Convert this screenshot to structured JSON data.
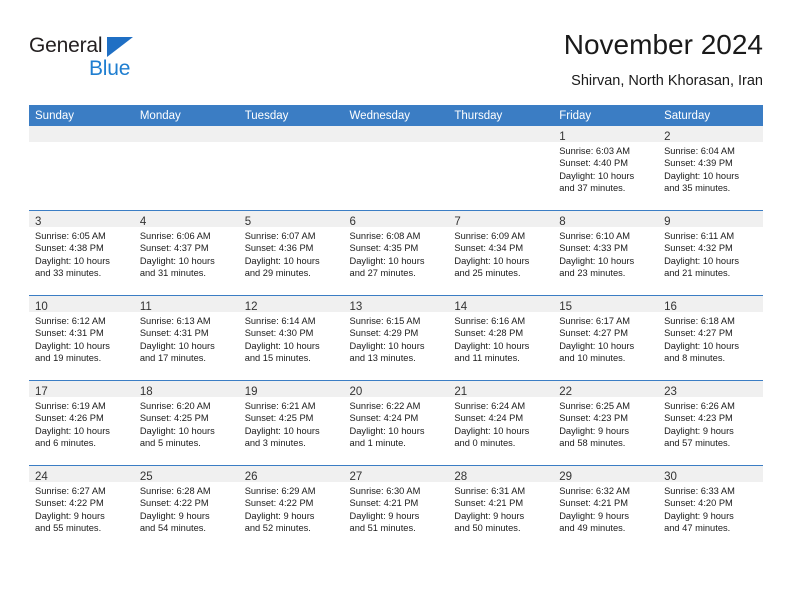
{
  "logo": {
    "word_one": "General",
    "word_two": "Blue",
    "triangle_icon": "triangle-icon",
    "brand_blue": "#1f7ed0"
  },
  "header": {
    "title": "November 2024",
    "subtitle": "Shirvan, North Khorasan, Iran"
  },
  "colors": {
    "header_blue": "#3b7dc4",
    "daynum_band": "#f0f0f0",
    "text": "#1a1a1a"
  },
  "weekday_headers": [
    "Sunday",
    "Monday",
    "Tuesday",
    "Wednesday",
    "Thursday",
    "Friday",
    "Saturday"
  ],
  "weeks": [
    [
      {
        "day": "",
        "lines": []
      },
      {
        "day": "",
        "lines": []
      },
      {
        "day": "",
        "lines": []
      },
      {
        "day": "",
        "lines": []
      },
      {
        "day": "",
        "lines": []
      },
      {
        "day": "1",
        "lines": [
          "Sunrise: 6:03 AM",
          "Sunset: 4:40 PM",
          "Daylight: 10 hours",
          "and 37 minutes."
        ]
      },
      {
        "day": "2",
        "lines": [
          "Sunrise: 6:04 AM",
          "Sunset: 4:39 PM",
          "Daylight: 10 hours",
          "and 35 minutes."
        ]
      }
    ],
    [
      {
        "day": "3",
        "lines": [
          "Sunrise: 6:05 AM",
          "Sunset: 4:38 PM",
          "Daylight: 10 hours",
          "and 33 minutes."
        ]
      },
      {
        "day": "4",
        "lines": [
          "Sunrise: 6:06 AM",
          "Sunset: 4:37 PM",
          "Daylight: 10 hours",
          "and 31 minutes."
        ]
      },
      {
        "day": "5",
        "lines": [
          "Sunrise: 6:07 AM",
          "Sunset: 4:36 PM",
          "Daylight: 10 hours",
          "and 29 minutes."
        ]
      },
      {
        "day": "6",
        "lines": [
          "Sunrise: 6:08 AM",
          "Sunset: 4:35 PM",
          "Daylight: 10 hours",
          "and 27 minutes."
        ]
      },
      {
        "day": "7",
        "lines": [
          "Sunrise: 6:09 AM",
          "Sunset: 4:34 PM",
          "Daylight: 10 hours",
          "and 25 minutes."
        ]
      },
      {
        "day": "8",
        "lines": [
          "Sunrise: 6:10 AM",
          "Sunset: 4:33 PM",
          "Daylight: 10 hours",
          "and 23 minutes."
        ]
      },
      {
        "day": "9",
        "lines": [
          "Sunrise: 6:11 AM",
          "Sunset: 4:32 PM",
          "Daylight: 10 hours",
          "and 21 minutes."
        ]
      }
    ],
    [
      {
        "day": "10",
        "lines": [
          "Sunrise: 6:12 AM",
          "Sunset: 4:31 PM",
          "Daylight: 10 hours",
          "and 19 minutes."
        ]
      },
      {
        "day": "11",
        "lines": [
          "Sunrise: 6:13 AM",
          "Sunset: 4:31 PM",
          "Daylight: 10 hours",
          "and 17 minutes."
        ]
      },
      {
        "day": "12",
        "lines": [
          "Sunrise: 6:14 AM",
          "Sunset: 4:30 PM",
          "Daylight: 10 hours",
          "and 15 minutes."
        ]
      },
      {
        "day": "13",
        "lines": [
          "Sunrise: 6:15 AM",
          "Sunset: 4:29 PM",
          "Daylight: 10 hours",
          "and 13 minutes."
        ]
      },
      {
        "day": "14",
        "lines": [
          "Sunrise: 6:16 AM",
          "Sunset: 4:28 PM",
          "Daylight: 10 hours",
          "and 11 minutes."
        ]
      },
      {
        "day": "15",
        "lines": [
          "Sunrise: 6:17 AM",
          "Sunset: 4:27 PM",
          "Daylight: 10 hours",
          "and 10 minutes."
        ]
      },
      {
        "day": "16",
        "lines": [
          "Sunrise: 6:18 AM",
          "Sunset: 4:27 PM",
          "Daylight: 10 hours",
          "and 8 minutes."
        ]
      }
    ],
    [
      {
        "day": "17",
        "lines": [
          "Sunrise: 6:19 AM",
          "Sunset: 4:26 PM",
          "Daylight: 10 hours",
          "and 6 minutes."
        ]
      },
      {
        "day": "18",
        "lines": [
          "Sunrise: 6:20 AM",
          "Sunset: 4:25 PM",
          "Daylight: 10 hours",
          "and 5 minutes."
        ]
      },
      {
        "day": "19",
        "lines": [
          "Sunrise: 6:21 AM",
          "Sunset: 4:25 PM",
          "Daylight: 10 hours",
          "and 3 minutes."
        ]
      },
      {
        "day": "20",
        "lines": [
          "Sunrise: 6:22 AM",
          "Sunset: 4:24 PM",
          "Daylight: 10 hours",
          "and 1 minute."
        ]
      },
      {
        "day": "21",
        "lines": [
          "Sunrise: 6:24 AM",
          "Sunset: 4:24 PM",
          "Daylight: 10 hours",
          "and 0 minutes."
        ]
      },
      {
        "day": "22",
        "lines": [
          "Sunrise: 6:25 AM",
          "Sunset: 4:23 PM",
          "Daylight: 9 hours",
          "and 58 minutes."
        ]
      },
      {
        "day": "23",
        "lines": [
          "Sunrise: 6:26 AM",
          "Sunset: 4:23 PM",
          "Daylight: 9 hours",
          "and 57 minutes."
        ]
      }
    ],
    [
      {
        "day": "24",
        "lines": [
          "Sunrise: 6:27 AM",
          "Sunset: 4:22 PM",
          "Daylight: 9 hours",
          "and 55 minutes."
        ]
      },
      {
        "day": "25",
        "lines": [
          "Sunrise: 6:28 AM",
          "Sunset: 4:22 PM",
          "Daylight: 9 hours",
          "and 54 minutes."
        ]
      },
      {
        "day": "26",
        "lines": [
          "Sunrise: 6:29 AM",
          "Sunset: 4:22 PM",
          "Daylight: 9 hours",
          "and 52 minutes."
        ]
      },
      {
        "day": "27",
        "lines": [
          "Sunrise: 6:30 AM",
          "Sunset: 4:21 PM",
          "Daylight: 9 hours",
          "and 51 minutes."
        ]
      },
      {
        "day": "28",
        "lines": [
          "Sunrise: 6:31 AM",
          "Sunset: 4:21 PM",
          "Daylight: 9 hours",
          "and 50 minutes."
        ]
      },
      {
        "day": "29",
        "lines": [
          "Sunrise: 6:32 AM",
          "Sunset: 4:21 PM",
          "Daylight: 9 hours",
          "and 49 minutes."
        ]
      },
      {
        "day": "30",
        "lines": [
          "Sunrise: 6:33 AM",
          "Sunset: 4:20 PM",
          "Daylight: 9 hours",
          "and 47 minutes."
        ]
      }
    ]
  ]
}
